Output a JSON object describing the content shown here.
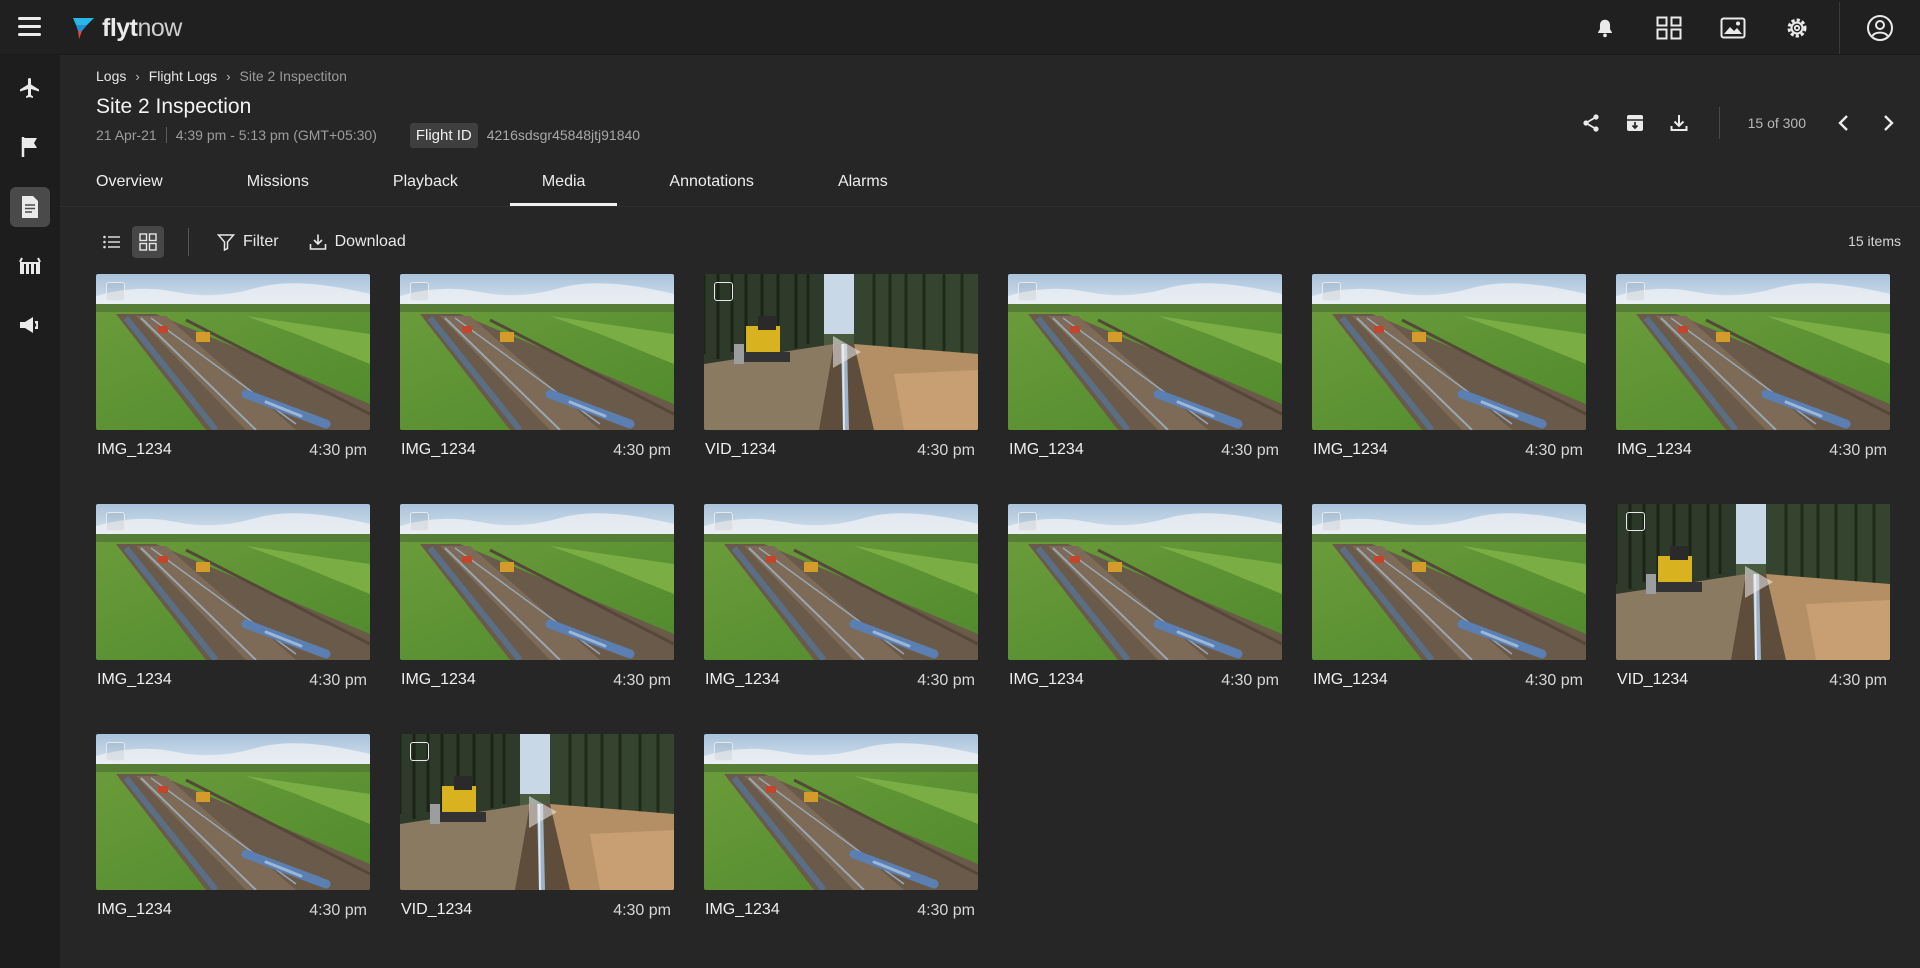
{
  "app": {
    "brand_main": "flyt",
    "brand_sub": "now"
  },
  "topbar": {
    "icons": [
      "notification-bell-icon",
      "dashboard-grid-icon",
      "gallery-image-icon",
      "settings-gear-icon",
      "user-account-icon"
    ]
  },
  "sidebar": {
    "items": [
      {
        "name": "flights",
        "icon": "airplane-icon",
        "active": false
      },
      {
        "name": "missions",
        "icon": "flag-icon",
        "active": false
      },
      {
        "name": "logs",
        "icon": "document-icon",
        "active": true
      },
      {
        "name": "fleet",
        "icon": "hangar-icon",
        "active": false
      },
      {
        "name": "alerts",
        "icon": "megaphone-icon",
        "active": false
      }
    ]
  },
  "breadcrumb": {
    "items": [
      "Logs",
      "Flight Logs"
    ],
    "current": "Site 2 Inspectiton"
  },
  "header": {
    "title": "Site 2 Inspection",
    "date": "21 Apr-21",
    "time_range": "4:39 pm - 5:13 pm (GMT+05:30)",
    "flight_id_label": "Flight ID",
    "flight_id": "4216sdsgr45848jtj91840"
  },
  "pager": {
    "text": "15 of 300"
  },
  "tabs": [
    {
      "label": "Overview",
      "active": false
    },
    {
      "label": "Missions",
      "active": false
    },
    {
      "label": "Playback",
      "active": false
    },
    {
      "label": "Media",
      "active": true
    },
    {
      "label": "Annotations",
      "active": false
    },
    {
      "label": "Alarms",
      "active": false
    }
  ],
  "toolbar": {
    "filter_label": "Filter",
    "download_label": "Download",
    "items_count": "15 items"
  },
  "media": [
    {
      "name": "IMG_1234",
      "time": "4:30 pm",
      "type": "image"
    },
    {
      "name": "IMG_1234",
      "time": "4:30 pm",
      "type": "image"
    },
    {
      "name": "VID_1234",
      "time": "4:30 pm",
      "type": "video"
    },
    {
      "name": "IMG_1234",
      "time": "4:30 pm",
      "type": "image"
    },
    {
      "name": "IMG_1234",
      "time": "4:30 pm",
      "type": "image"
    },
    {
      "name": "IMG_1234",
      "time": "4:30 pm",
      "type": "image"
    },
    {
      "name": "IMG_1234",
      "time": "4:30 pm",
      "type": "image"
    },
    {
      "name": "IMG_1234",
      "time": "4:30 pm",
      "type": "image"
    },
    {
      "name": "IMG_1234",
      "time": "4:30 pm",
      "type": "image"
    },
    {
      "name": "IMG_1234",
      "time": "4:30 pm",
      "type": "image"
    },
    {
      "name": "IMG_1234",
      "time": "4:30 pm",
      "type": "image"
    },
    {
      "name": "VID_1234",
      "time": "4:30 pm",
      "type": "video"
    },
    {
      "name": "IMG_1234",
      "time": "4:30 pm",
      "type": "image"
    },
    {
      "name": "VID_1234",
      "time": "4:30 pm",
      "type": "video"
    },
    {
      "name": "IMG_1234",
      "time": "4:30 pm",
      "type": "image"
    }
  ]
}
